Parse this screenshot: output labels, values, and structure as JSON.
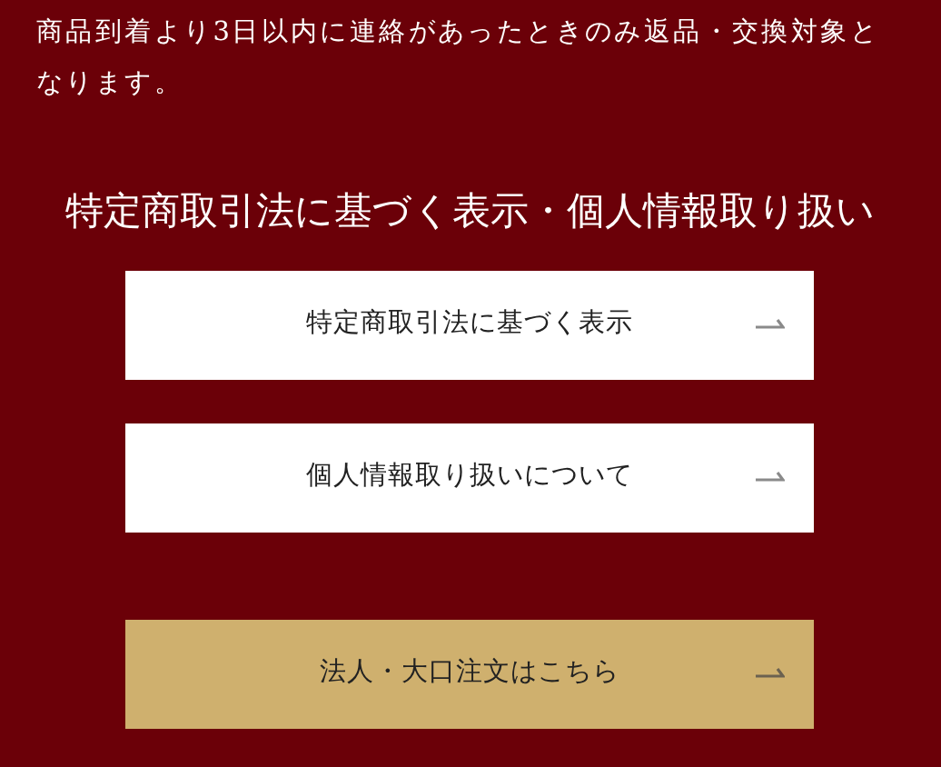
{
  "notice": "商品到着より3日以内に連絡があったときのみ返品・交換対象となります。",
  "section": {
    "title": "特定商取引法に基づく表示・個人情報取り扱い",
    "links": [
      {
        "label": "特定商取引法に基づく表示",
        "kind": "plain"
      },
      {
        "label": "個人情報取り扱いについて",
        "kind": "plain"
      }
    ]
  },
  "order_button": {
    "label": "法人・大口注文はこちら",
    "kind": "gold"
  }
}
